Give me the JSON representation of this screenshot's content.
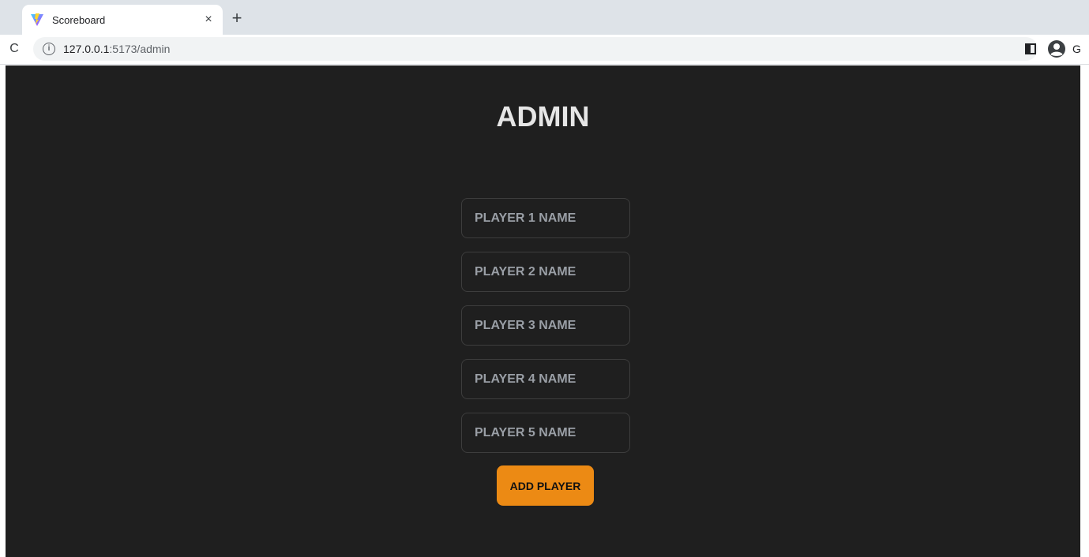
{
  "browser": {
    "tab_title": "Scoreboard",
    "tab_close_glyph": "×",
    "new_tab_glyph": "+",
    "reload_glyph": "C",
    "url_host": "127.0.0.1",
    "url_rest": ":5173/admin",
    "profile_letter": "G",
    "icons": [
      "vite-favicon-icon",
      "close-icon",
      "plus-icon",
      "reload-icon",
      "info-icon",
      "side-panel-icon",
      "profile-icon"
    ]
  },
  "page": {
    "title": "ADMIN",
    "inputs": [
      {
        "placeholder": "PLAYER 1 NAME",
        "value": ""
      },
      {
        "placeholder": "PLAYER 2 NAME",
        "value": ""
      },
      {
        "placeholder": "PLAYER 3 NAME",
        "value": ""
      },
      {
        "placeholder": "PLAYER 4 NAME",
        "value": ""
      },
      {
        "placeholder": "PLAYER 5 NAME",
        "value": ""
      }
    ],
    "add_button_label": "ADD PLAYER"
  },
  "colors": {
    "page_background": "#1f1f1f",
    "accent": "#ec8a14",
    "title_text": "#e6e6e6",
    "placeholder_text": "#9a9fa6"
  }
}
